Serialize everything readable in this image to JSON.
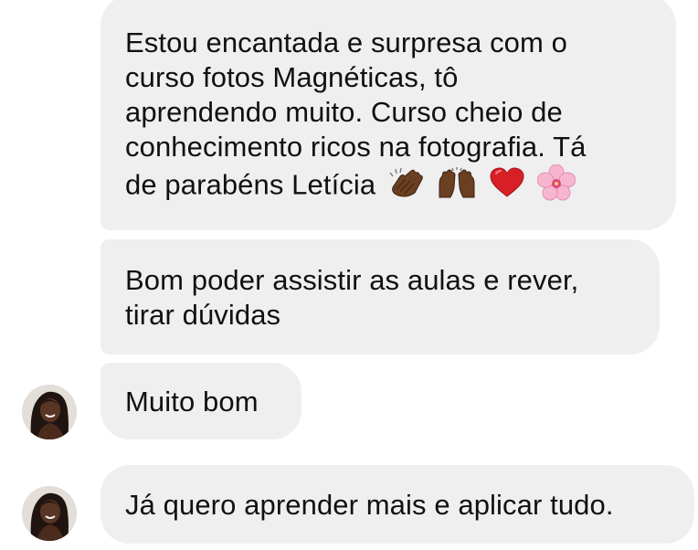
{
  "messages": [
    {
      "lines": [
        "Estou encantada e surpresa com o",
        "curso fotos Magnéticas, tô",
        "aprendendo muito. Curso cheio de",
        "conhecimento ricos na fotografia. Tá",
        "de parabéns Letícia"
      ],
      "emojis": [
        "clapping-hands",
        "raising-hands",
        "red-heart",
        "cherry-blossom"
      ]
    },
    {
      "lines": [
        "Bom poder assistir as aulas e rever,",
        "tirar dúvidas"
      ]
    },
    {
      "lines": [
        "Muito bom"
      ]
    },
    {
      "lines": [
        "Já quero aprender mais e aplicar tudo."
      ]
    }
  ],
  "colors": {
    "bubble": "#efefef",
    "text": "#111111",
    "background": "#ffffff",
    "skin": "#5a3524",
    "hair": "#1f1410"
  }
}
